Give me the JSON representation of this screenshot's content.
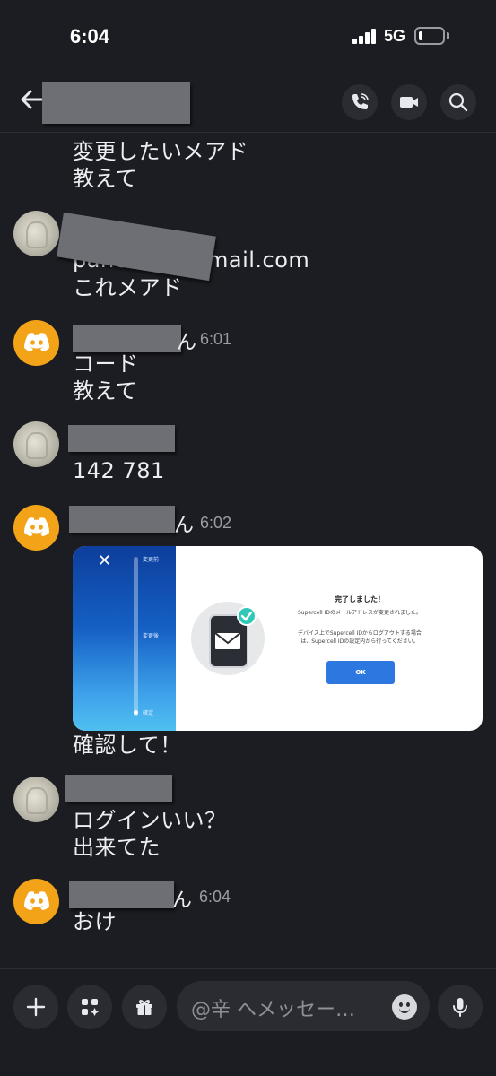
{
  "status_bar": {
    "time": "6:04",
    "network": "5G"
  },
  "header": {
    "buttons": [
      "voice-call",
      "video-call",
      "search"
    ]
  },
  "messages": {
    "m1": {
      "lines": [
        "変更したいメアド",
        "教えて"
      ]
    },
    "m2": {
      "lines": [
        "pane",
        "mail.com",
        "これメアド"
      ]
    },
    "m3": {
      "time": "6:01",
      "name_tail": "ん",
      "lines": [
        "コード",
        "教えて"
      ]
    },
    "m4": {
      "lines": [
        "142 781"
      ]
    },
    "m5": {
      "time": "6:02",
      "name_tail": "ん",
      "caption": "確認して！"
    },
    "m6": {
      "lines": [
        "ログインいい？",
        "出来てた"
      ]
    },
    "m7": {
      "time": "6:04",
      "name_tail": "ん",
      "lines": [
        "おけ"
      ]
    }
  },
  "embed": {
    "close": "✕",
    "steps": [
      "変更前",
      "変更後",
      "確定"
    ],
    "title": "完了しました！",
    "body1": "Supercell IDのメールアドレスが変更されました。",
    "body2": "デバイス上でSupercell IDからログアウトする場合は、Supercell IDの設定内から行ってください。",
    "ok": "OK"
  },
  "composer": {
    "placeholder": "@辛 へメッセー…"
  }
}
